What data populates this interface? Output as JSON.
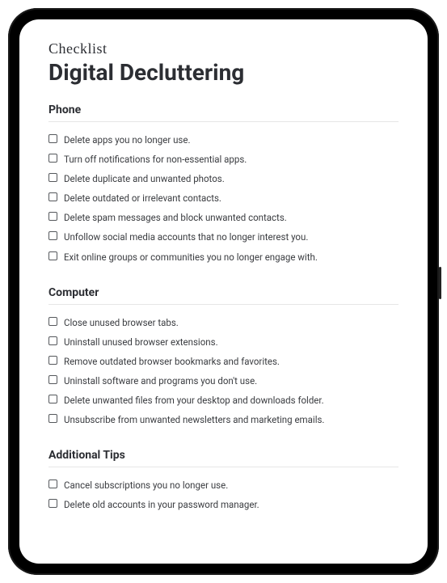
{
  "eyebrow": "Checklist",
  "title": "Digital Decluttering",
  "sections": [
    {
      "heading": "Phone",
      "items": [
        "Delete apps you no longer use.",
        "Turn off notifications for non-essential apps.",
        "Delete duplicate and unwanted photos.",
        "Delete outdated or irrelevant contacts.",
        "Delete spam messages and block unwanted contacts.",
        "Unfollow social media accounts that no longer interest you.",
        "Exit online groups or communities you no longer engage with."
      ]
    },
    {
      "heading": "Computer",
      "items": [
        "Close unused browser tabs.",
        "Uninstall unused browser extensions.",
        "Remove outdated browser bookmarks and favorites.",
        "Uninstall software and programs you don't use.",
        "Delete unwanted files from your desktop and downloads folder.",
        "Unsubscribe from unwanted newsletters and marketing emails."
      ]
    },
    {
      "heading": "Additional Tips",
      "items": [
        "Cancel subscriptions you no longer use.",
        "Delete old accounts in your password manager."
      ]
    }
  ]
}
